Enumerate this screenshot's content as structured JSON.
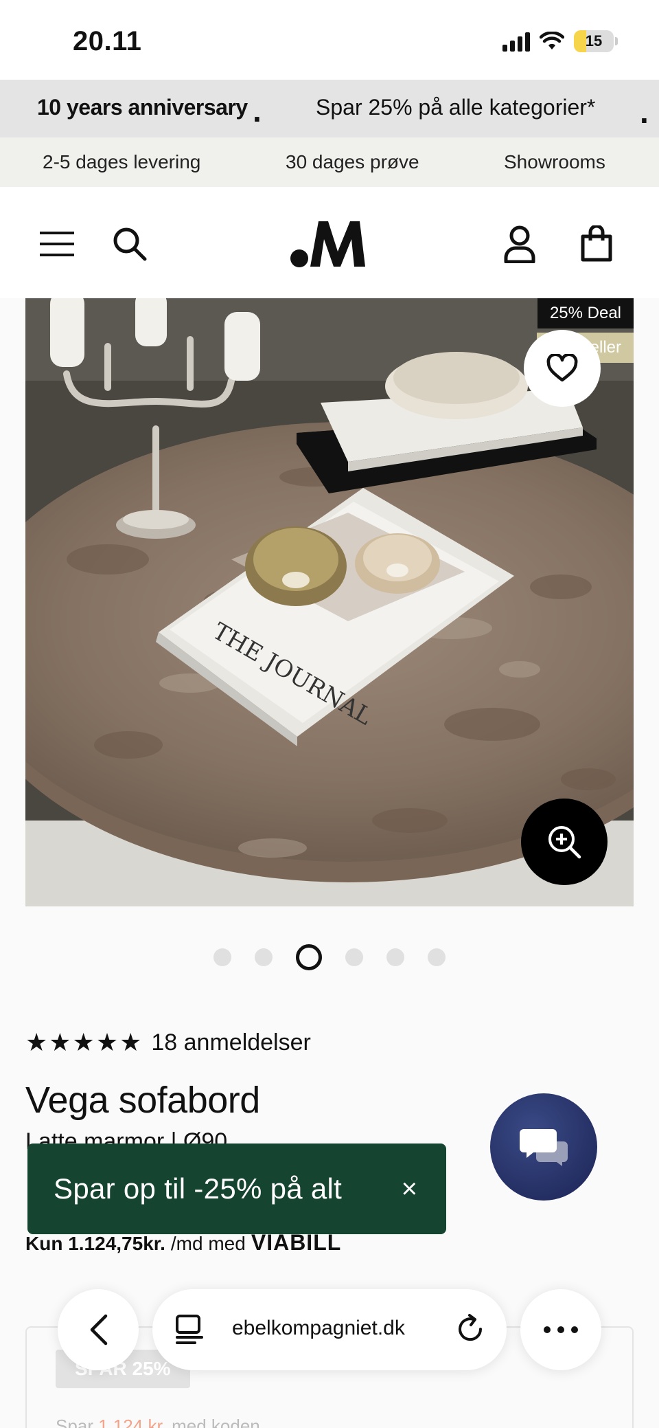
{
  "status_bar": {
    "time": "20.11",
    "battery": "15"
  },
  "promo": {
    "bold": "10 years anniversary",
    "text": "Spar 25% på alle kategorier*"
  },
  "usp": [
    "2-5 dages levering",
    "30 dages prøve",
    "Showrooms"
  ],
  "header": {
    "icons": [
      "menu-icon",
      "search-icon",
      "user-icon",
      "bag-icon"
    ]
  },
  "hero": {
    "deal_badge": "25% Deal",
    "bestseller_badge": "Bestseller",
    "active_slide": 3,
    "slides": 6
  },
  "product": {
    "stars": "★★★★★",
    "rating": 5,
    "reviews": "18 anmeldelser",
    "title": "Vega sofabord",
    "variant": "Latte marmor | Ø90",
    "monthly_price": "Kun 1.124,75kr.",
    "monthly_suffix": "/md med",
    "financing": "VIABILL"
  },
  "toast": {
    "text": "Spar op til -25% på alt",
    "close": "×"
  },
  "offer": {
    "badge": "SPAR 25%",
    "text_prefix": "Spar",
    "amount": "1.124 kr.",
    "text_suffix": "med koden"
  },
  "browser": {
    "url": "ebelkompagniet.dk"
  },
  "colors": {
    "toast_bg": "#154431",
    "chat_bg": "#1b2354",
    "bestseller": "#cfc8a0"
  }
}
